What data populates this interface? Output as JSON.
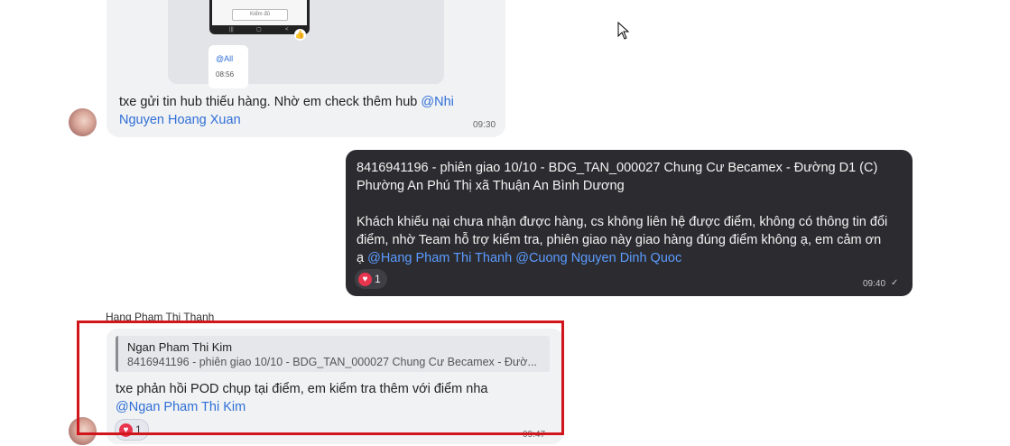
{
  "messages": {
    "incoming_1": {
      "media": {
        "phone_button": "Kiểm đủ",
        "thumb_reaction": "👍",
        "card_mention": "@All",
        "card_time": "08:56"
      },
      "text_line1": "txe gửi tin hub thiếu hàng. Nhờ em check thêm hub ",
      "mention_part1": "@Nhi",
      "mention_part2": "Nguyen Hoang Xuan",
      "time": "09:30"
    },
    "outgoing_1": {
      "line1": "8416941196 - phiên giao 10/10 - BDG_TAN_000027  Chung Cư Becamex - Đường D1 (C)",
      "line2": "Phường An Phú Thị xã Thuận An Bình Dương",
      "line3": "Khách khiếu nại chưa nhận được hàng, cs không liên hệ được điểm, không có thông tin đổi",
      "line4": "điểm, nhờ Team hỗ trợ kiểm tra, phiên giao này giao hàng đúng điểm không ạ, em cảm ơn",
      "line5_prefix": "ạ ",
      "mention_1": "@Hang Pham Thi Thanh",
      "mention_2": "@Cuong Nguyen Dinh Quoc",
      "reaction_count": "1",
      "time": "09:40",
      "status": "✓"
    },
    "incoming_2": {
      "sender": "Hang Pham Thi Thanh",
      "quote_name": "Ngan Pham Thi Kim",
      "quote_text": "8416941196 - phiên giao 10/10 - BDG_TAN_000027 Chung Cư Becamex - Đườ...",
      "text_line1": "txe phản hồi POD chụp tại điểm, em kiểm tra thêm với điểm nha",
      "mention": "@Ngan Pham Thi Kim",
      "reaction_count": "1",
      "time": "09:47"
    }
  },
  "colors": {
    "mention": "#2f6fd6",
    "outgoing_bg": "#2c2c30",
    "incoming_bg": "#f1f2f4",
    "highlight": "#d0161c",
    "heart": "#e8344d"
  },
  "icons": {
    "heart": "heart-icon",
    "check": "check-icon",
    "cursor": "cursor-icon",
    "thumb": "thumbs-up-icon"
  }
}
